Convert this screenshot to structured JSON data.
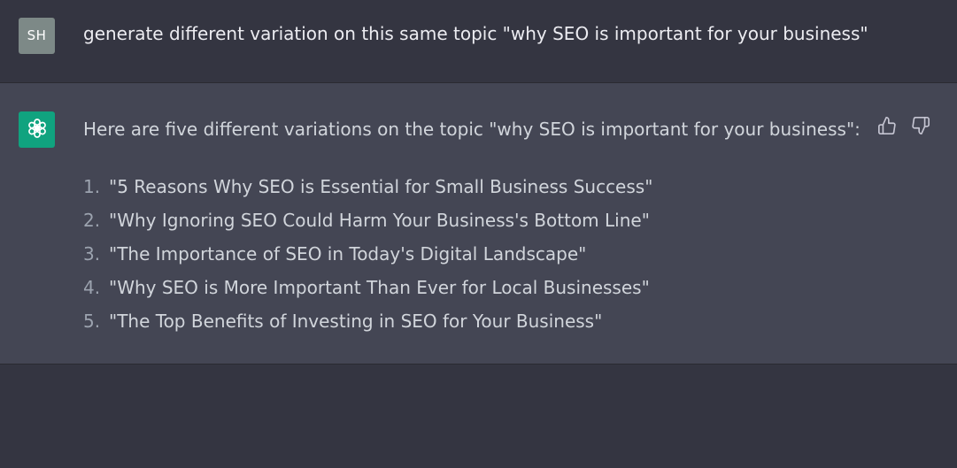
{
  "user_message": {
    "avatar_initials": "SH",
    "text": "generate different variation on this same topic \"why SEO is important for your business\""
  },
  "assistant_message": {
    "avatar_icon": "openai-logo-icon",
    "intro": "Here are five different variations on the topic \"why SEO is important for your business\":",
    "items": [
      {
        "num": "1.",
        "text": "\"5 Reasons Why SEO is Essential for Small Business Success\""
      },
      {
        "num": "2.",
        "text": "\"Why Ignoring SEO Could Harm Your Business's Bottom Line\""
      },
      {
        "num": "3.",
        "text": "\"The Importance of SEO in Today's Digital Landscape\""
      },
      {
        "num": "4.",
        "text": "\"Why SEO is More Important Than Ever for Local Businesses\""
      },
      {
        "num": "5.",
        "text": "\"The Top Benefits of Investing in SEO for Your Business\""
      }
    ],
    "feedback_icons": [
      "thumbs-up-icon",
      "thumbs-down-icon"
    ]
  },
  "colors": {
    "background": "#343541",
    "assistant_background": "#444654",
    "user_avatar": "#7d8987",
    "assistant_avatar": "#10a37f"
  }
}
